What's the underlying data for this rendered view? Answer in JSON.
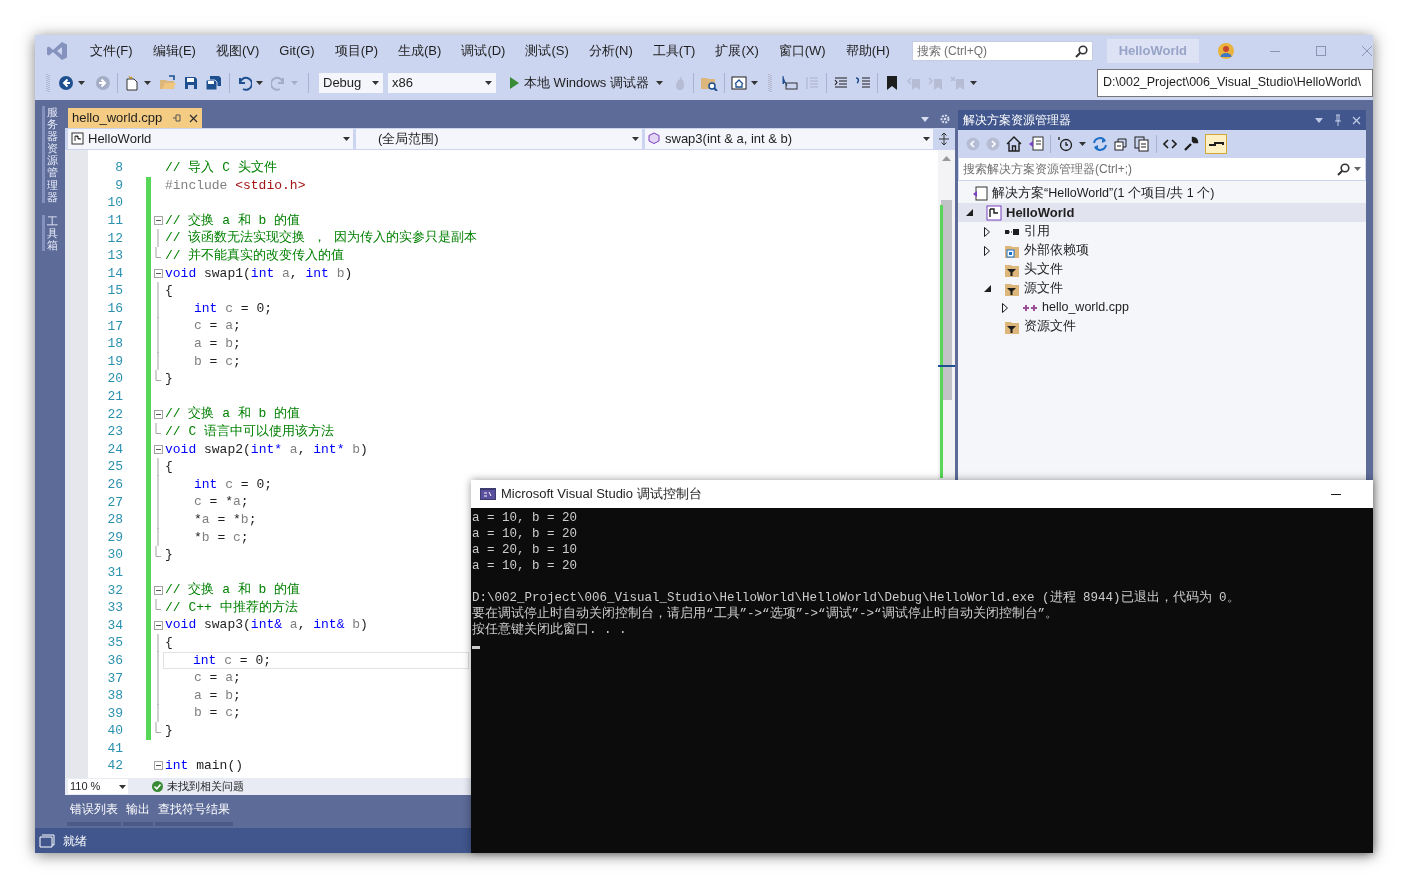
{
  "menu": [
    "文件(F)",
    "编辑(E)",
    "视图(V)",
    "Git(G)",
    "项目(P)",
    "生成(B)",
    "调试(D)",
    "测试(S)",
    "分析(N)",
    "工具(T)",
    "扩展(X)",
    "窗口(W)",
    "帮助(H)"
  ],
  "search": {
    "placeholder": "搜索 (Ctrl+Q)"
  },
  "solution_name": "HelloWorld",
  "toolbar": {
    "configuration": "Debug",
    "platform": "x86",
    "run_label": "本地 Windows 调试器",
    "path": "D:\\002_Project\\006_Visual_Studio\\HelloWorld\\"
  },
  "side_tabs": [
    "服务器资源管理器",
    "工具箱"
  ],
  "editor": {
    "tabs": [
      {
        "label": "hello_world.cpp",
        "selected": true
      }
    ],
    "nav": [
      "HelloWorld",
      "(全局范围)",
      "swap3(int & a, int & b)"
    ],
    "lines": [
      {
        "num": "8",
        "kind": "code",
        "changed": false,
        "current": false,
        "indented": false,
        "tokens": [
          {
            "kind": "comment",
            "text": "// 导入 C 头文件"
          }
        ]
      },
      {
        "num": "9",
        "kind": "code",
        "changed": true,
        "current": false,
        "indented": false,
        "tokens": [
          {
            "kind": "preproc",
            "text": "#include "
          },
          {
            "kind": "string",
            "text": "<stdio.h>"
          }
        ]
      },
      {
        "num": "10",
        "kind": "code",
        "changed": true,
        "current": false,
        "indented": false
      },
      {
        "num": "11",
        "kind": "fold_open",
        "changed": true,
        "current": false,
        "indented": false,
        "tokens": [
          {
            "kind": "comment",
            "text": "// 交换 a 和 b 的值"
          }
        ]
      },
      {
        "num": "12",
        "kind": "fold_body",
        "changed": true,
        "current": false,
        "indented": false,
        "tokens": [
          {
            "kind": "comment",
            "text": "// 该函数无法实现交换 ， 因为传入的实参只是副本"
          }
        ]
      },
      {
        "num": "13",
        "kind": "fold_end",
        "changed": true,
        "current": false,
        "indented": false,
        "tokens": [
          {
            "kind": "comment",
            "text": "// 并不能真实的改变传入的值"
          }
        ]
      },
      {
        "num": "14",
        "kind": "fold_open",
        "changed": true,
        "current": false,
        "indented": false,
        "tokens": [
          {
            "kind": "keyword",
            "text": "void"
          },
          {
            "kind": "plain",
            "text": " swap1("
          },
          {
            "kind": "keyword",
            "text": "int"
          },
          {
            "kind": "name",
            "text": " a"
          },
          {
            "kind": "plain",
            "text": ", "
          },
          {
            "kind": "keyword",
            "text": "int"
          },
          {
            "kind": "name",
            "text": " b"
          },
          {
            "kind": "plain",
            "text": ")"
          }
        ]
      },
      {
        "num": "15",
        "kind": "fold_body",
        "changed": true,
        "current": false,
        "indented": false,
        "tokens": [
          {
            "kind": "plain",
            "text": "{"
          }
        ]
      },
      {
        "num": "16",
        "kind": "fold_body",
        "changed": true,
        "current": false,
        "indented": true,
        "tokens": [
          {
            "kind": "keyword",
            "text": "int"
          },
          {
            "kind": "name",
            "text": " c"
          },
          {
            "kind": "plain",
            "text": " = 0;"
          }
        ]
      },
      {
        "num": "17",
        "kind": "fold_body",
        "changed": true,
        "current": false,
        "indented": true,
        "tokens": [
          {
            "kind": "name",
            "text": "c"
          },
          {
            "kind": "plain",
            "text": " = "
          },
          {
            "kind": "name",
            "text": "a"
          },
          {
            "kind": "plain",
            "text": ";"
          }
        ]
      },
      {
        "num": "18",
        "kind": "fold_body",
        "changed": true,
        "current": false,
        "indented": true,
        "tokens": [
          {
            "kind": "name",
            "text": "a"
          },
          {
            "kind": "plain",
            "text": " = "
          },
          {
            "kind": "name",
            "text": "b"
          },
          {
            "kind": "plain",
            "text": ";"
          }
        ]
      },
      {
        "num": "19",
        "kind": "fold_body",
        "changed": true,
        "current": false,
        "indented": true,
        "tokens": [
          {
            "kind": "name",
            "text": "b"
          },
          {
            "kind": "plain",
            "text": " = "
          },
          {
            "kind": "name",
            "text": "c"
          },
          {
            "kind": "plain",
            "text": ";"
          }
        ]
      },
      {
        "num": "20",
        "kind": "fold_end",
        "changed": true,
        "current": false,
        "indented": false,
        "tokens": [
          {
            "kind": "plain",
            "text": "}"
          }
        ]
      },
      {
        "num": "21",
        "kind": "code",
        "changed": true,
        "current": false,
        "indented": false
      },
      {
        "num": "22",
        "kind": "fold_open",
        "changed": true,
        "current": false,
        "indented": false,
        "tokens": [
          {
            "kind": "comment",
            "text": "// 交换 a 和 b 的值"
          }
        ]
      },
      {
        "num": "23",
        "kind": "fold_end",
        "changed": true,
        "current": false,
        "indented": false,
        "tokens": [
          {
            "kind": "comment",
            "text": "// C 语言中可以使用该方法"
          }
        ]
      },
      {
        "num": "24",
        "kind": "fold_open",
        "changed": true,
        "current": false,
        "indented": false,
        "tokens": [
          {
            "kind": "keyword",
            "text": "void"
          },
          {
            "kind": "plain",
            "text": " swap2("
          },
          {
            "kind": "keyword",
            "text": "int*"
          },
          {
            "kind": "name",
            "text": " a"
          },
          {
            "kind": "plain",
            "text": ", "
          },
          {
            "kind": "keyword",
            "text": "int*"
          },
          {
            "kind": "name",
            "text": " b"
          },
          {
            "kind": "plain",
            "text": ")"
          }
        ]
      },
      {
        "num": "25",
        "kind": "fold_body",
        "changed": true,
        "current": false,
        "indented": false,
        "tokens": [
          {
            "kind": "plain",
            "text": "{"
          }
        ]
      },
      {
        "num": "26",
        "kind": "fold_body",
        "changed": true,
        "current": false,
        "indented": true,
        "tokens": [
          {
            "kind": "keyword",
            "text": "int"
          },
          {
            "kind": "name",
            "text": " c"
          },
          {
            "kind": "plain",
            "text": " = 0;"
          }
        ]
      },
      {
        "num": "27",
        "kind": "fold_body",
        "changed": true,
        "current": false,
        "indented": true,
        "tokens": [
          {
            "kind": "name",
            "text": "c"
          },
          {
            "kind": "plain",
            "text": " = *"
          },
          {
            "kind": "name",
            "text": "a"
          },
          {
            "kind": "plain",
            "text": ";"
          }
        ]
      },
      {
        "num": "28",
        "kind": "fold_body",
        "changed": true,
        "current": false,
        "indented": true,
        "tokens": [
          {
            "kind": "plain",
            "text": "*"
          },
          {
            "kind": "name",
            "text": "a"
          },
          {
            "kind": "plain",
            "text": " = *"
          },
          {
            "kind": "name",
            "text": "b"
          },
          {
            "kind": "plain",
            "text": ";"
          }
        ]
      },
      {
        "num": "29",
        "kind": "fold_body",
        "changed": true,
        "current": false,
        "indented": true,
        "tokens": [
          {
            "kind": "plain",
            "text": "*"
          },
          {
            "kind": "name",
            "text": "b"
          },
          {
            "kind": "plain",
            "text": " = "
          },
          {
            "kind": "name",
            "text": "c"
          },
          {
            "kind": "plain",
            "text": ";"
          }
        ]
      },
      {
        "num": "30",
        "kind": "fold_end",
        "changed": true,
        "current": false,
        "indented": false,
        "tokens": [
          {
            "kind": "plain",
            "text": "}"
          }
        ]
      },
      {
        "num": "31",
        "kind": "code",
        "changed": true,
        "current": false,
        "indented": false
      },
      {
        "num": "32",
        "kind": "fold_open",
        "changed": true,
        "current": false,
        "indented": false,
        "tokens": [
          {
            "kind": "comment",
            "text": "// 交换 a 和 b 的值"
          }
        ]
      },
      {
        "num": "33",
        "kind": "fold_end",
        "changed": true,
        "current": false,
        "indented": false,
        "tokens": [
          {
            "kind": "comment",
            "text": "// C++ 中推荐的方法"
          }
        ]
      },
      {
        "num": "34",
        "kind": "fold_open",
        "changed": true,
        "current": false,
        "indented": false,
        "tokens": [
          {
            "kind": "keyword",
            "text": "void"
          },
          {
            "kind": "plain",
            "text": " swap3("
          },
          {
            "kind": "keyword",
            "text": "int&"
          },
          {
            "kind": "name",
            "text": " a"
          },
          {
            "kind": "plain",
            "text": ", "
          },
          {
            "kind": "keyword",
            "text": "int&"
          },
          {
            "kind": "name",
            "text": " b"
          },
          {
            "kind": "plain",
            "text": ")"
          }
        ]
      },
      {
        "num": "35",
        "kind": "fold_body",
        "changed": true,
        "current": false,
        "indented": false,
        "tokens": [
          {
            "kind": "plain",
            "text": "{"
          }
        ]
      },
      {
        "num": "36",
        "kind": "fold_body",
        "changed": true,
        "current": true,
        "indented": true,
        "tokens": [
          {
            "kind": "keyword",
            "text": "int"
          },
          {
            "kind": "name",
            "text": " c"
          },
          {
            "kind": "plain",
            "text": " = 0;"
          }
        ]
      },
      {
        "num": "37",
        "kind": "fold_body",
        "changed": true,
        "current": false,
        "indented": true,
        "tokens": [
          {
            "kind": "name",
            "text": "c"
          },
          {
            "kind": "plain",
            "text": " = "
          },
          {
            "kind": "name",
            "text": "a"
          },
          {
            "kind": "plain",
            "text": ";"
          }
        ]
      },
      {
        "num": "38",
        "kind": "fold_body",
        "changed": true,
        "current": false,
        "indented": true,
        "tokens": [
          {
            "kind": "name",
            "text": "a"
          },
          {
            "kind": "plain",
            "text": " = "
          },
          {
            "kind": "name",
            "text": "b"
          },
          {
            "kind": "plain",
            "text": ";"
          }
        ]
      },
      {
        "num": "39",
        "kind": "fold_body",
        "changed": true,
        "current": false,
        "indented": true,
        "tokens": [
          {
            "kind": "name",
            "text": "b"
          },
          {
            "kind": "plain",
            "text": " = "
          },
          {
            "kind": "name",
            "text": "c"
          },
          {
            "kind": "plain",
            "text": ";"
          }
        ]
      },
      {
        "num": "40",
        "kind": "fold_end",
        "changed": true,
        "current": false,
        "indented": false,
        "tokens": [
          {
            "kind": "plain",
            "text": "}"
          }
        ]
      },
      {
        "num": "41",
        "kind": "code",
        "changed": false,
        "current": false,
        "indented": false
      },
      {
        "num": "42",
        "kind": "fold_open",
        "changed": false,
        "current": false,
        "indented": false,
        "tokens": [
          {
            "kind": "keyword",
            "text": "int"
          },
          {
            "kind": "plain",
            "text": " main()"
          }
        ]
      }
    ],
    "zoom": "110 %",
    "issues": "未找到相关问题"
  },
  "bottom_tabs": [
    "错误列表",
    "输出",
    "查找符号结果"
  ],
  "solution_explorer": {
    "title": "解决方案资源管理器",
    "search": {
      "placeholder": "搜索解决方案资源管理器(Ctrl+;)"
    },
    "tree": [
      {
        "label": "解决方案“HelloWorld”(1 个项目/共 1 个)",
        "kind": "solution",
        "selected": false,
        "children": [
          {
            "label": "HelloWorld",
            "kind": "project",
            "selected": true,
            "expanded": true,
            "children": [
              {
                "label": "引用",
                "kind": "references",
                "selected": false,
                "expanded": false
              },
              {
                "label": "外部依赖项",
                "kind": "external",
                "selected": false,
                "expanded": false
              },
              {
                "label": "头文件",
                "kind": "filter",
                "selected": false
              },
              {
                "label": "源文件",
                "kind": "filter",
                "selected": false,
                "expanded": true,
                "children": [
                  {
                    "label": "hello_world.cpp",
                    "kind": "file",
                    "selected": false,
                    "expanded": false
                  }
                ]
              },
              {
                "label": "资源文件",
                "kind": "filter",
                "selected": false
              }
            ]
          }
        ]
      }
    ]
  },
  "console": {
    "title": "Microsoft Visual Studio 调试控制台",
    "output": [
      "a = 10, b = 20",
      "a = 10, b = 20",
      "a = 20, b = 10",
      "a = 10, b = 20"
    ],
    "messages": [
      "D:\\002_Project\\006_Visual_Studio\\HelloWorld\\HelloWorld\\Debug\\HelloWorld.exe (进程 8944)已退出，代码为 0。",
      "要在调试停止时自动关闭控制台，请启用“工具”->“选项”->“调试”->“调试停止时自动关闭控制台”。",
      "按任意键关闭此窗口. . ."
    ]
  },
  "status": "就绪"
}
